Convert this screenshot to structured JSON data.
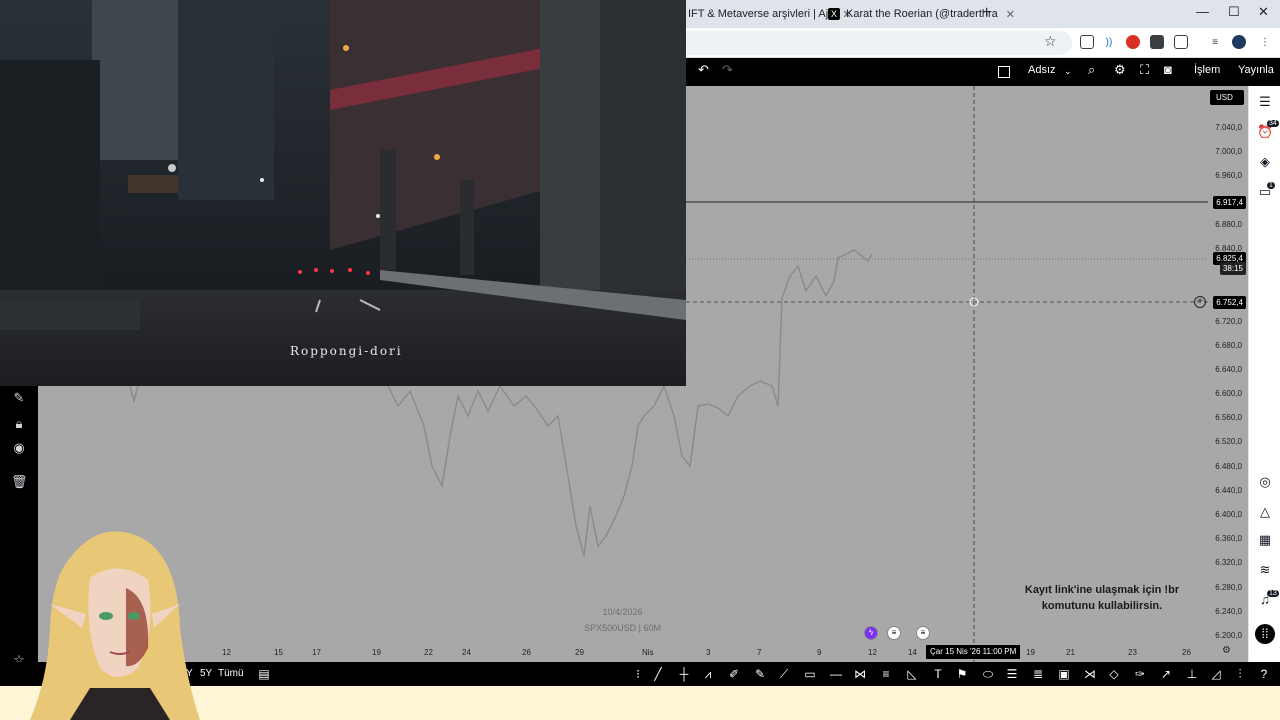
{
  "browser": {
    "tabs": [
      {
        "label": "IFT & Metaverse arşivleri | Aja"
      },
      {
        "label": "Karat the Roerian (@traderthra",
        "icon": "X"
      }
    ],
    "new_tab": "+",
    "window": {
      "minimize": "—",
      "maximize": "☐",
      "close": "✕"
    }
  },
  "tv_toolbar": {
    "layout_name": "Adsız",
    "trade_button": "İşlem",
    "publish_button": "Yayınla"
  },
  "price_axis": {
    "currency": "USD",
    "labels": [
      "7.040,0",
      "7.000,0",
      "6.960,0",
      "6.880,0",
      "6.840,0",
      "6.720,0",
      "6.680,0",
      "6.640,0",
      "6.600,0",
      "6.560,0",
      "6.520,0",
      "6.480,0",
      "6.440,0",
      "6.400,0",
      "6.360,0",
      "6.320,0",
      "6.280,0",
      "6.240,0",
      "6.200,0"
    ],
    "tag_line": "6.917,4",
    "tag_last": "6.825,4",
    "tag_countdown": "38:15",
    "tag_cursor": "6.752,4"
  },
  "time_axis": {
    "labels": [
      "12",
      "15",
      "17",
      "19",
      "22",
      "24",
      "26",
      "29",
      "Nis",
      "3",
      "7",
      "9",
      "12",
      "14",
      "19",
      "21",
      "23",
      "26"
    ],
    "cursor_date": "Çar 15 Nis '26   11:00 PM"
  },
  "watermark": {
    "date": "10/4/2026",
    "symbol": "SPX500USD | 60M"
  },
  "overlay": {
    "line1": "Kayıt link'ine ulaşmak için !br",
    "line2": "komutunu kullabilirsin."
  },
  "bottom_bar": {
    "range_5y": "5Y",
    "range_all": "Tümü"
  },
  "video": {
    "caption": "Roppongi-dori"
  },
  "right_bar": {
    "badge_alerts": "34",
    "badge_chat": "1",
    "badge_notify": "13"
  }
}
